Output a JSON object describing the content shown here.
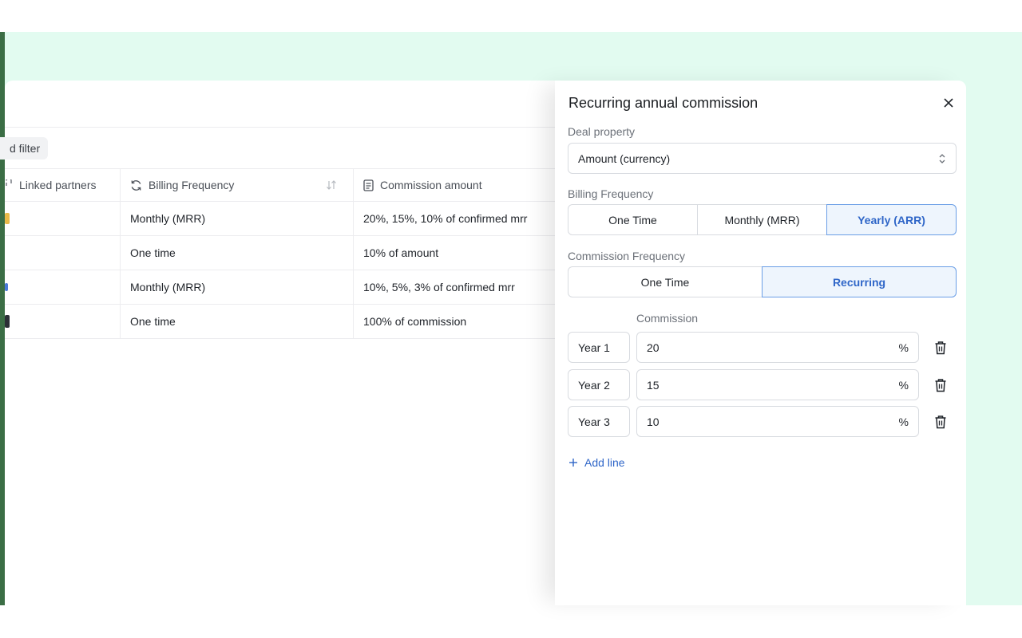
{
  "background_table": {
    "filter_chip": "d filter",
    "columns": [
      {
        "label": "Linked partners",
        "icon": "link-icon"
      },
      {
        "label": "Billing Frequency",
        "icon": "refresh-icon"
      },
      {
        "label": "Commission amount",
        "icon": "document-icon"
      }
    ],
    "rows": [
      {
        "billing": "Monthly (MRR)",
        "commission": "20%, 15%, 10% of confirmed mrr",
        "badge_color": "#e9b949"
      },
      {
        "billing": "One time",
        "commission": "10% of amount",
        "badge_color": ""
      },
      {
        "billing": "Monthly (MRR)",
        "commission": "10%, 5%, 3% of confirmed mrr",
        "badge_color": "#4a79d8"
      },
      {
        "billing": "One time",
        "commission": "100% of commission",
        "badge_color": "#2b2f36"
      }
    ]
  },
  "panel": {
    "title": "Recurring annual commission",
    "deal_property_label": "Deal property",
    "deal_property_value": "Amount (currency)",
    "billing_label": "Billing Frequency",
    "billing_options": [
      "One Time",
      "Monthly (MRR)",
      "Yearly (ARR)"
    ],
    "billing_selected": "Yearly (ARR)",
    "commission_frequency_label": "Commission Frequency",
    "commission_options": [
      "One Time",
      "Recurring"
    ],
    "commission_selected": "Recurring",
    "commission_column_label": "Commission",
    "lines": [
      {
        "year": "Year 1",
        "value": "20",
        "unit": "%"
      },
      {
        "year": "Year 2",
        "value": "15",
        "unit": "%"
      },
      {
        "year": "Year 3",
        "value": "10",
        "unit": "%"
      }
    ],
    "add_line_label": "Add line"
  },
  "colors": {
    "accent": "#2f66c8",
    "active_bg": "#eef5fd",
    "page_bg": "#e2fbf0"
  }
}
